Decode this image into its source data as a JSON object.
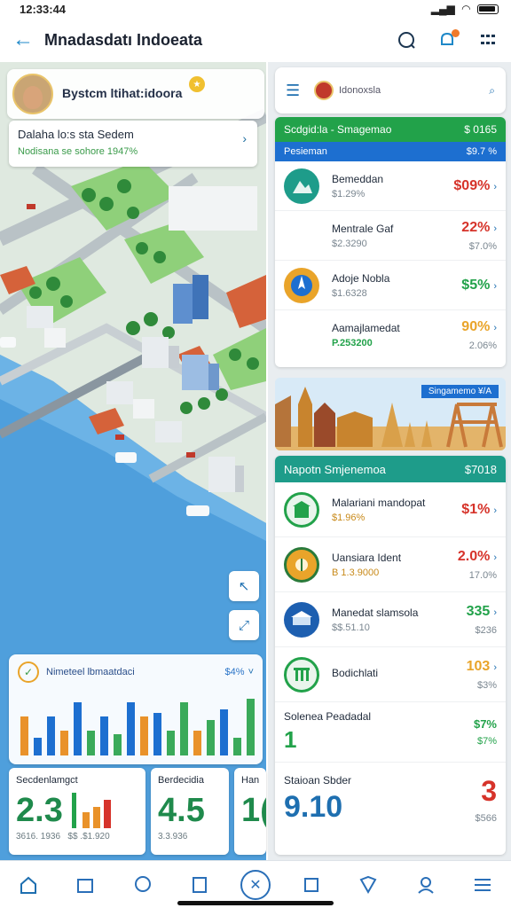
{
  "status": {
    "time": "12:33:44"
  },
  "app": {
    "title": "Mnadasdatı Indoeata"
  },
  "map": {
    "user_card": {
      "title": "Bystcm ltihat:idoora",
      "subtitle": ""
    },
    "location_card": {
      "title": "Dalaha  lo:s  sta  Sedem",
      "subtitle": "Nodisana se sohore 1947%"
    },
    "chart_card": {
      "title": "Nimeteel lbmaatdaci",
      "value": "$4%",
      "chart_data": {
        "type": "bar",
        "categories": [
          "1",
          "2",
          "3",
          "4",
          "5",
          "6",
          "7",
          "8",
          "9",
          "10",
          "11",
          "12",
          "13",
          "14",
          "15",
          "16",
          "17",
          "18"
        ],
        "values": [
          0.55,
          0.25,
          0.55,
          0.35,
          0.75,
          0.35,
          0.55,
          0.3,
          0.75,
          0.55,
          0.6,
          0.35,
          0.75,
          0.35,
          0.5,
          0.65,
          0.25,
          0.8
        ],
        "colors": [
          "#e9922a",
          "#1d6fd0",
          "#1d6fd0",
          "#e9922a",
          "#1d6fd0",
          "#3aaa5a",
          "#1d6fd0",
          "#3aaa5a",
          "#1d6fd0",
          "#e9922a",
          "#1d6fd0",
          "#3aaa5a",
          "#3aaa5a",
          "#e9922a",
          "#3aaa5a",
          "#1d6fd0",
          "#3aaa5a",
          "#3aaa5a"
        ]
      }
    },
    "stat_cards": [
      {
        "label": "Secdenlamgct",
        "value": "2.3",
        "foot": "3616. 1936",
        "foot2": "$$ .$1.920"
      },
      {
        "label": "Berdecidia",
        "value": "4.5",
        "foot": "3.3.936"
      },
      {
        "label": "Han",
        "value": "1(",
        "foot": ""
      }
    ]
  },
  "panel": {
    "header_title": "Idonoxsla",
    "section1": {
      "title": "Scdgid:la - Smagemao",
      "value": "$ 0165",
      "sub_title": "Pesieman",
      "sub_value": "$9.7 %",
      "rows": [
        {
          "name": "Bemeddan",
          "sub": "$1.29%",
          "value": "$09%",
          "value2": "",
          "value_color": "red"
        },
        {
          "name": "Mentrale Gaf",
          "sub": "$2.3290",
          "value": "22%",
          "value2": "$7.0%",
          "value_color": "red"
        },
        {
          "name": "Adoje Nobla",
          "sub": "$1.6328",
          "value": "$5%",
          "value2": "",
          "value_color": "green"
        },
        {
          "name": "Aamajlamedat",
          "sub": "P.253200",
          "value": "90%",
          "value2": "2.06%",
          "value_color": "yellow"
        }
      ]
    },
    "banner": {
      "label": "Singamemo   ¥/A"
    },
    "section2": {
      "title": "Napotn  Smjenemoa",
      "value": "$7018",
      "rows": [
        {
          "name": "Malariani mandopat",
          "sub": "$1.96%",
          "value": "$1%",
          "value2": "",
          "value_color": "red"
        },
        {
          "name": "Uansiara Ident",
          "sub": "B 1.3.9000",
          "value": "2.0%",
          "value2": "17.0%",
          "value_color": "red"
        },
        {
          "name": "Manedat slamsola",
          "sub": "$$.51.10",
          "value": "335",
          "value2": "$236",
          "value_color": "green"
        },
        {
          "name": "Bodichlati",
          "sub": "",
          "value": "103",
          "value2": "$3%",
          "value_color": "yellow"
        },
        {
          "name": "Solenea Peadadal",
          "sub": "1",
          "value": "$7%",
          "value2": "$7%",
          "value_color": "green"
        },
        {
          "name": "Staioan Sbder",
          "sub": "9.10",
          "value": "3",
          "value2": "$566",
          "value_color": "red"
        }
      ]
    }
  },
  "icons": [
    "back-arrow-icon",
    "help-icon",
    "notification-icon",
    "grid-icon",
    "home-icon",
    "calendar-icon",
    "chat-icon",
    "file-icon",
    "close-icon",
    "map-icon",
    "shield-icon",
    "user-icon",
    "menu-icon"
  ]
}
